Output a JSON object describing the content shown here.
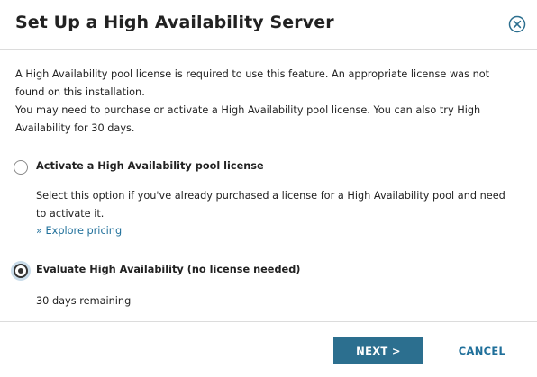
{
  "dialog": {
    "title": "Set Up a High Availability Server",
    "close_icon": "close-circle-icon"
  },
  "intro": {
    "line1": "A High Availability pool license is required to use this feature. An appropriate license was not found on this installation.",
    "line2": "You may need to purchase or activate a High Availability pool license. You can also try High Availability for 30 days."
  },
  "options": [
    {
      "label": "Activate a High Availability pool license",
      "selected": false,
      "description": "Select this option if you've already purchased a license for a High Availability pool and need to activate it.",
      "link": "» Explore pricing"
    },
    {
      "label": "Evaluate High Availability (no license needed)",
      "selected": true,
      "description": "30 days remaining"
    }
  ],
  "footer": {
    "next_label": "NEXT >",
    "cancel_label": "CANCEL"
  },
  "colors": {
    "primary_button": "#2c6f8f",
    "link": "#1f6f9a",
    "focus_ring": "#c9dcea"
  }
}
